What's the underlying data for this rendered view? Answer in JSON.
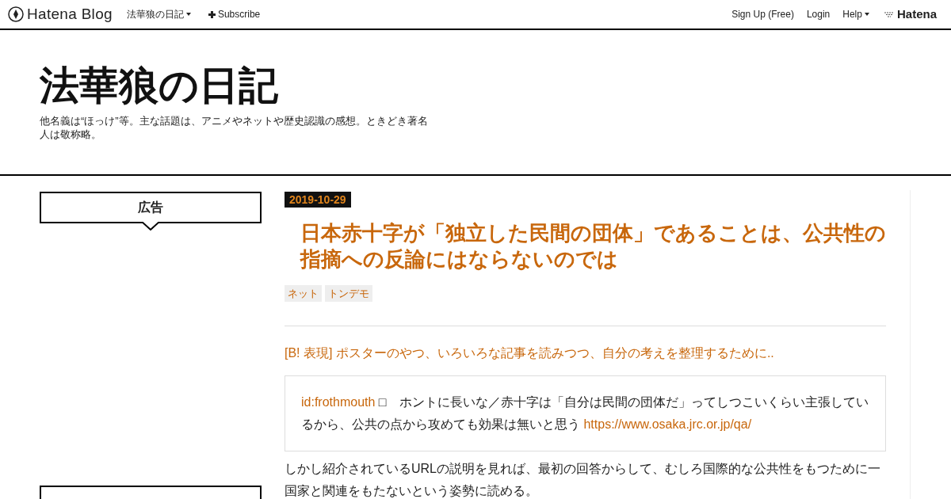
{
  "global_header": {
    "brand": "Hatena Blog",
    "blog_menu": "法華狼の日記",
    "subscribe": "Subscribe",
    "right_links": [
      "Sign Up (Free)",
      "Login"
    ],
    "help": "Help",
    "hatena": "Hatena"
  },
  "blog_header": {
    "title": "法華狼の日記",
    "description": "他名義は“ほっけ”等。主な話題は、アニメやネットや歴史認識の感想。ときどき著名人は敬称略。"
  },
  "sidebar": {
    "modules": [
      {
        "title": "広告"
      }
    ]
  },
  "entry": {
    "date": "2019-10-29",
    "title": "日本赤十字が「独立した民間の団体」であることは、公共性の指摘への反論にはならないのでは",
    "categories": [
      "ネット",
      "トンデモ"
    ],
    "bookmark_link": "[B! 表現] ポスターのやつ、いろいろな記事を読みつつ、自分の考えを整理するために..",
    "quote": {
      "user": "id:frothmouth",
      "text": "□　ホントに長いな／赤十字は「自分は民間の団体だ」ってしつこいくらい主張しているから、公共の点から攻めても効果は無いと思う",
      "url": "https://www.osaka.jrc.or.jp/qa/"
    },
    "body": "しかし紹介されているURLの説明を見れば、最初の回答からして、むしろ国際的な公共性をもつために一国家と関連をもたないという姿勢に読める。"
  }
}
